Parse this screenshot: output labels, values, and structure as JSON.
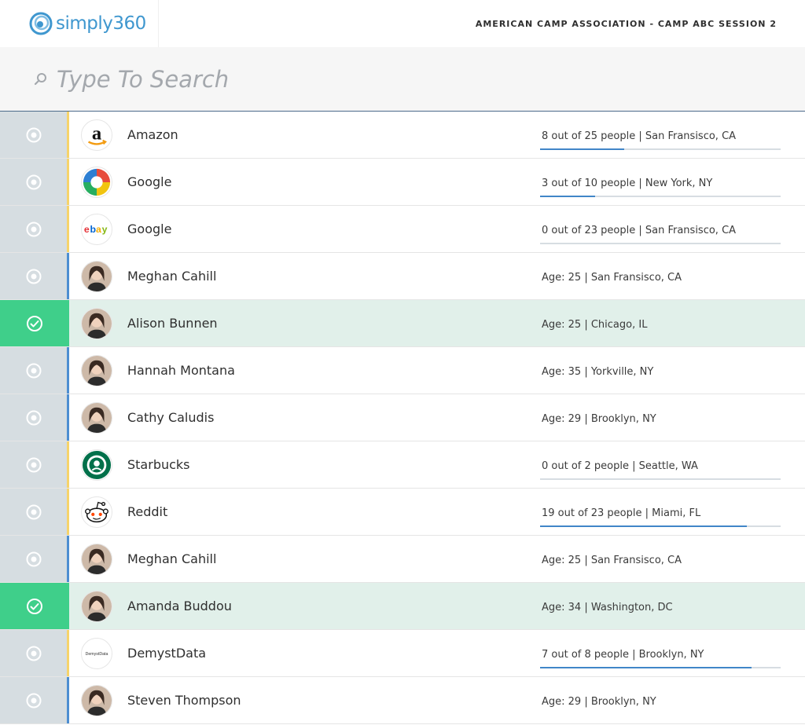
{
  "header": {
    "brand": "simply360",
    "session": "AMERICAN CAMP ASSOCIATION - CAMP ABC SESSION 2",
    "brand_color": "#3f97cf"
  },
  "search": {
    "placeholder": "Type To Search",
    "icon": "search-icon"
  },
  "colors": {
    "selected_row": "#e1f0ea",
    "selected_cell": "#3fcf8a",
    "company_bar": "#f6d36b",
    "person_bar": "#4d8ed1",
    "progress": "#4186c8"
  },
  "rows": [
    {
      "name": "Amazon",
      "type": "company",
      "avatar": "amazon-logo",
      "info": "8 out of 25 people  |  San Fransisco, CA",
      "progress": 0.35,
      "selected": false
    },
    {
      "name": "Google",
      "type": "company",
      "avatar": "google-logo",
      "info": "3 out of 10 people  |  New York, NY",
      "progress": 0.23,
      "selected": false
    },
    {
      "name": "Google",
      "type": "company",
      "avatar": "ebay-logo",
      "info": "0 out of 23 people  |  San Fransisco, CA",
      "progress": 0.0,
      "selected": false
    },
    {
      "name": "Meghan Cahill",
      "type": "person",
      "avatar": "person-avatar",
      "info": "Age: 25  |  San Fransisco, CA",
      "selected": false
    },
    {
      "name": "Alison Bunnen",
      "type": "person",
      "avatar": "person-avatar",
      "info": "Age: 25  |  Chicago, IL",
      "selected": true
    },
    {
      "name": "Hannah Montana",
      "type": "person",
      "avatar": "person-avatar",
      "info": "Age: 35  |  Yorkville, NY",
      "selected": false
    },
    {
      "name": "Cathy Caludis",
      "type": "person",
      "avatar": "person-avatar",
      "info": "Age: 29  |  Brooklyn, NY",
      "selected": false
    },
    {
      "name": "Starbucks",
      "type": "company",
      "avatar": "starbucks-logo",
      "info": "0 out of 2 people  |  Seattle, WA",
      "progress": 0.0,
      "selected": false
    },
    {
      "name": "Reddit",
      "type": "company",
      "avatar": "reddit-logo",
      "info": "19 out of 23 people  |  Miami, FL",
      "progress": 0.86,
      "selected": false
    },
    {
      "name": "Meghan Cahill",
      "type": "person",
      "avatar": "person-avatar",
      "info": "Age: 25  |  San Fransisco, CA",
      "selected": false
    },
    {
      "name": "Amanda Buddou",
      "type": "person",
      "avatar": "person-avatar",
      "info": "Age: 34  |  Washington, DC",
      "selected": true
    },
    {
      "name": "DemystData",
      "type": "company",
      "avatar": "demystdata-logo",
      "info": "7 out of 8 people  |  Brooklyn, NY",
      "progress": 0.88,
      "selected": false
    },
    {
      "name": "Steven Thompson",
      "type": "person",
      "avatar": "person-avatar",
      "info": "Age: 29  |  Brooklyn, NY",
      "selected": false
    }
  ]
}
